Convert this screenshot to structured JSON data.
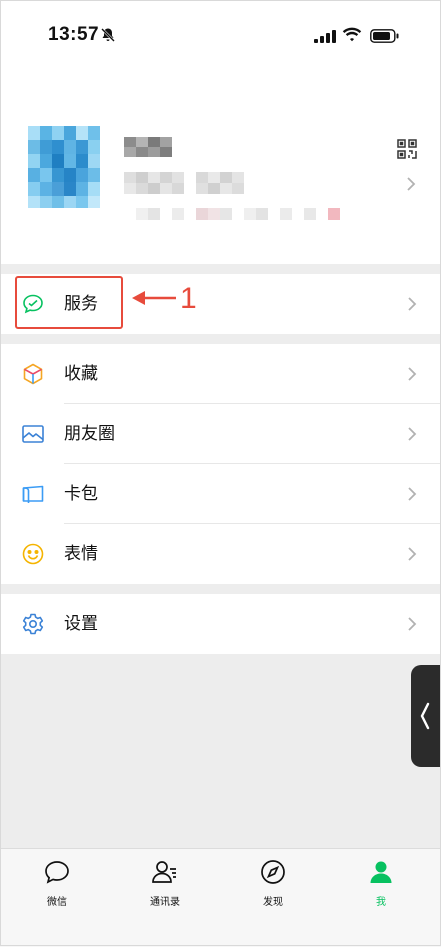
{
  "status_bar": {
    "time": "13:57"
  },
  "profile": {},
  "annotation": {
    "number": "1"
  },
  "menu": {
    "service": "服务",
    "favorites": "收藏",
    "moments": "朋友圈",
    "cards": "卡包",
    "stickers": "表情",
    "settings": "设置"
  },
  "tabbar": {
    "chats": "微信",
    "contacts": "通讯录",
    "discover": "发现",
    "me": "我"
  },
  "colors": {
    "accent": "#07c160",
    "annotation": "#e74b3c"
  }
}
